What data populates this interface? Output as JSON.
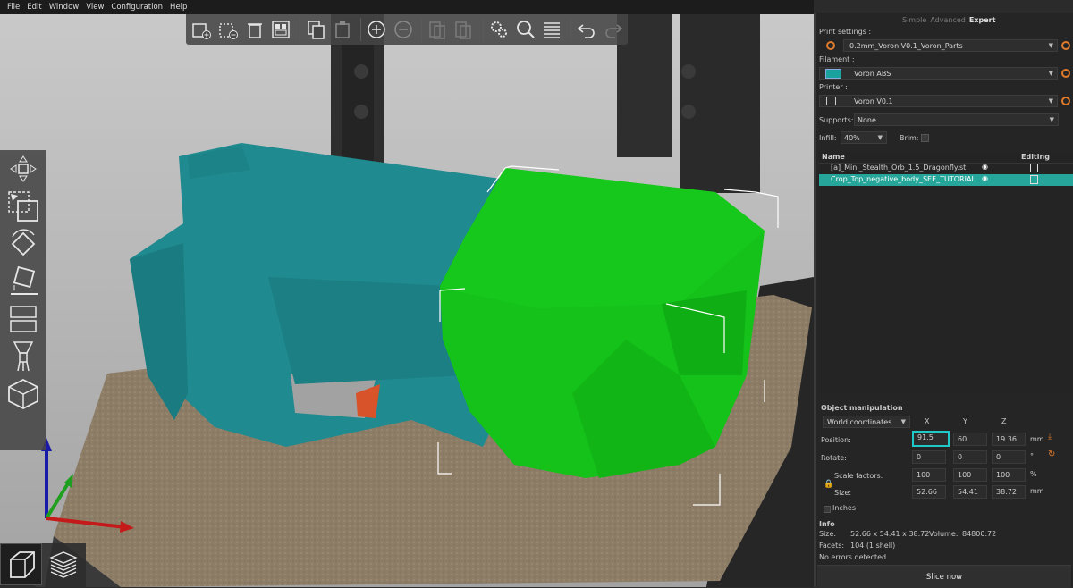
{
  "menu": [
    "File",
    "Edit",
    "Window",
    "View",
    "Configuration",
    "Help"
  ],
  "toolbar": {
    "buttons": [
      "add-icon",
      "delete-icon",
      "delete-all-icon",
      "arrange-icon",
      "copy-icon",
      "paste-icon",
      "increase-instances-icon",
      "decrease-instances-icon",
      "split-objects-icon",
      "split-parts-icon",
      "layer-settings-icon",
      "search-icon",
      "layers-editing-icon",
      "undo-icon",
      "redo-icon"
    ]
  },
  "left_tools": [
    "move-icon",
    "scale-icon",
    "rotate-icon",
    "place-on-face-icon",
    "cut-icon",
    "paint-supports-icon",
    "seam-painting-icon"
  ],
  "view_tabs": [
    "3d-view-icon",
    "preview-icon"
  ],
  "sidebar": {
    "modes": [
      "Simple",
      "Advanced",
      "Expert"
    ],
    "active_mode": "Expert",
    "print_settings_label": "Print settings :",
    "print_settings_value": "0.2mm_Voron V0.1_Voron_Parts",
    "filament_label": "Filament :",
    "filament_value": "Voron ABS",
    "filament_color": "#1aa39e",
    "printer_label": "Printer :",
    "printer_value": "Voron V0.1",
    "supports_label": "Supports:",
    "supports_value": "None",
    "infill_label": "Infill:",
    "infill_value": "40%",
    "brim_label": "Brim:",
    "list_header_name": "Name",
    "list_header_editing": "Editing",
    "objects": [
      {
        "name": "[a]_Mini_Stealth_Orb_1.5_Dragonfly.stl",
        "selected": false
      },
      {
        "name": "Crop_Top_negative_body_SEE_TUTORIAL",
        "selected": true
      }
    ]
  },
  "object_manipulation": {
    "title": "Object manipulation",
    "coord_mode": "World coordinates",
    "axes": [
      "X",
      "Y",
      "Z"
    ],
    "position_label": "Position:",
    "position": [
      "91.5",
      "60",
      "19.36"
    ],
    "position_unit": "mm",
    "rotate_label": "Rotate:",
    "rotate": [
      "0",
      "0",
      "0"
    ],
    "rotate_unit": "°",
    "scale_label": "Scale factors:",
    "scale": [
      "100",
      "100",
      "100"
    ],
    "scale_unit": "%",
    "size_label": "Size:",
    "size": [
      "52.66",
      "54.41",
      "38.72"
    ],
    "size_unit": "mm",
    "inches_label": "Inches"
  },
  "info": {
    "title": "Info",
    "size_label": "Size:",
    "size_value": "52.66 x 54.41 x 38.72",
    "volume_label": "Volume:",
    "volume_value": "84800.72",
    "facets_label": "Facets:",
    "facets_value": "104 (1 shell)",
    "errors": "No errors detected"
  },
  "slice_button": "Slice now",
  "colors": {
    "accent": "#26a69a",
    "highlight": "#20c8c8",
    "model": "#1f8a8f",
    "negative_volume": "#14c21a",
    "bed": "#8f7f67",
    "orange": "#e07b2c"
  }
}
